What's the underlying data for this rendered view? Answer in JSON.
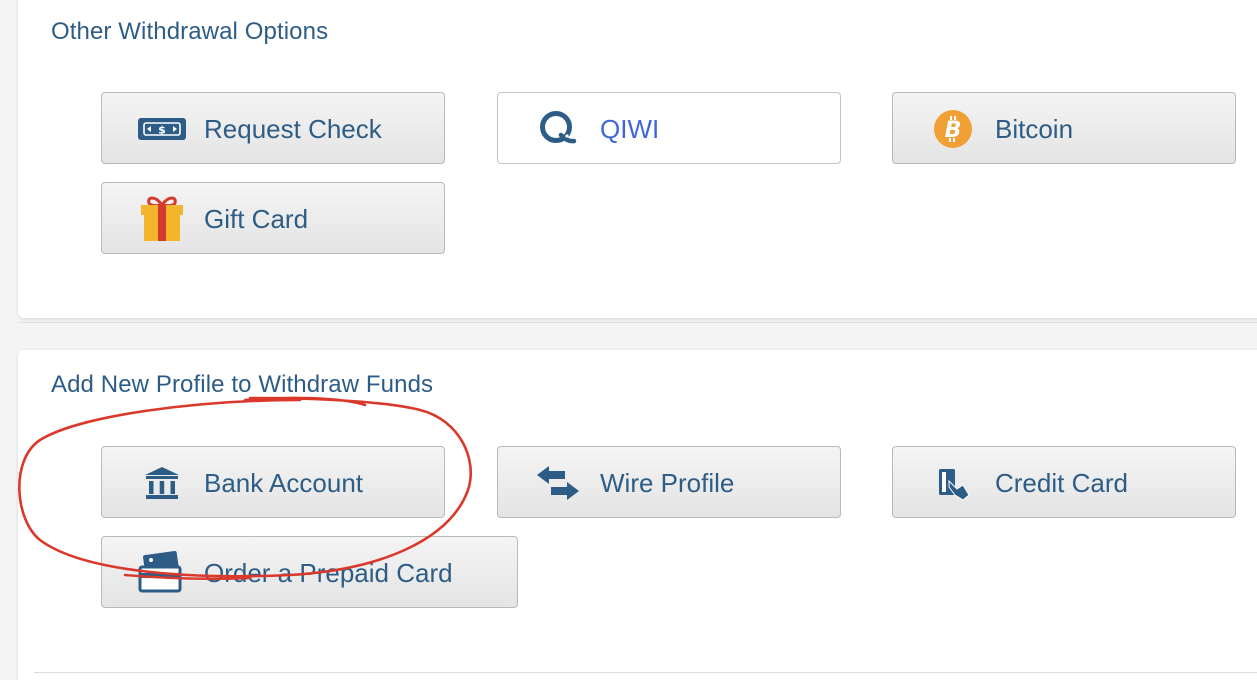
{
  "other_withdrawal": {
    "title": "Other Withdrawal Options",
    "buttons": {
      "request_check": {
        "label": "Request Check",
        "icon": "check-money-icon"
      },
      "qiwi": {
        "label": "QIWI",
        "icon": "qiwi-icon"
      },
      "bitcoin": {
        "label": "Bitcoin",
        "icon": "bitcoin-icon"
      },
      "gift_card": {
        "label": "Gift Card",
        "icon": "gift-icon"
      }
    }
  },
  "add_profile": {
    "title": "Add New Profile to Withdraw Funds",
    "buttons": {
      "bank_account": {
        "label": "Bank Account",
        "icon": "bank-icon"
      },
      "wire_profile": {
        "label": "Wire Profile",
        "icon": "transfer-arrows-icon"
      },
      "credit_card": {
        "label": "Credit Card",
        "icon": "card-swipe-icon"
      },
      "prepaid_card": {
        "label": "Order a Prepaid Card",
        "icon": "prepaid-card-icon"
      }
    }
  },
  "colors": {
    "text_primary": "#2d5d86",
    "qiwi_text": "#3f67d9",
    "bitcoin_orange": "#f0a034",
    "annotation_red": "#d9382b"
  }
}
